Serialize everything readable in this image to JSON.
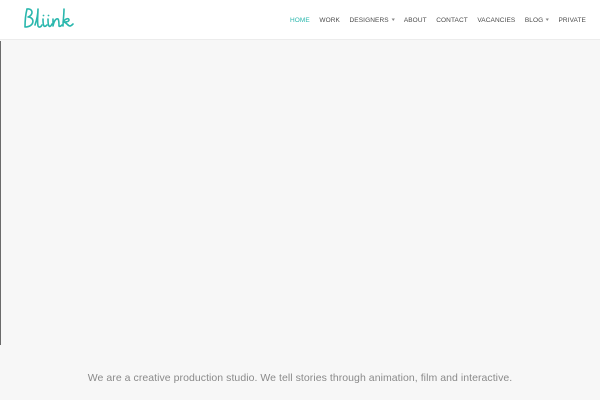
{
  "brand": {
    "logo_text": "Bliink",
    "accent_color": "#2ab7ad"
  },
  "nav": {
    "items": [
      {
        "label": "HOME",
        "active": true,
        "has_dropdown": false
      },
      {
        "label": "WORK",
        "active": false,
        "has_dropdown": false
      },
      {
        "label": "DESIGNERS",
        "active": false,
        "has_dropdown": true
      },
      {
        "label": "ABOUT",
        "active": false,
        "has_dropdown": false
      },
      {
        "label": "CONTACT",
        "active": false,
        "has_dropdown": false
      },
      {
        "label": "VACANCIES",
        "active": false,
        "has_dropdown": false
      },
      {
        "label": "BLOG",
        "active": false,
        "has_dropdown": true
      },
      {
        "label": "PRIVATE",
        "active": false,
        "has_dropdown": false
      }
    ],
    "dropdown_icon": "chevron-down-icon"
  },
  "main": {
    "tagline": "We are a creative production studio. We tell stories through animation, film and interactive."
  }
}
